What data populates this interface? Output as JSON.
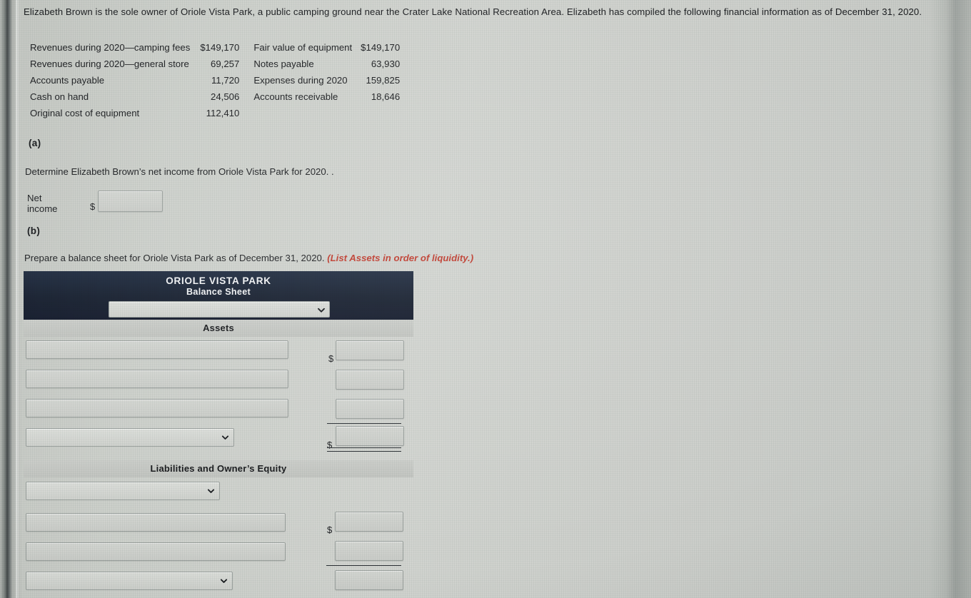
{
  "problem": {
    "intro": "Elizabeth Brown is the sole owner of Oriole Vista Park, a public camping ground near the Crater Lake National Recreation Area. Elizabeth has compiled the following financial information as of December 31, 2020.",
    "facts_left": [
      {
        "label": "Revenues during 2020—camping fees",
        "amount": "$149,170"
      },
      {
        "label": "Revenues during 2020—general store",
        "amount": "69,257"
      },
      {
        "label": "Accounts payable",
        "amount": "11,720"
      },
      {
        "label": "Cash on hand",
        "amount": "24,506"
      },
      {
        "label": "Original cost of equipment",
        "amount": "112,410"
      }
    ],
    "facts_right": [
      {
        "label": "Fair value of equipment",
        "amount": "$149,170"
      },
      {
        "label": "Notes payable",
        "amount": "63,930"
      },
      {
        "label": "Expenses during 2020",
        "amount": "159,825"
      },
      {
        "label": "Accounts receivable",
        "amount": "18,646"
      }
    ]
  },
  "part_a": {
    "label": "(a)",
    "question": "Determine Elizabeth Brown’s net income from Oriole Vista Park for 2020. .",
    "net_income_label": "Net income",
    "dollar_sign": "$",
    "net_income_value": "",
    "net_income_placeholder": ""
  },
  "part_b": {
    "label": "(b)",
    "question": "Prepare a balance sheet for Oriole Vista Park as of December 31, 2020.",
    "hint": "(List Assets in order of liquidity.)"
  },
  "balance_sheet": {
    "company": "ORIOLE VISTA PARK",
    "statement": "Balance Sheet",
    "date_select_value": "",
    "date_select_options": [
      ""
    ],
    "assets_band": "Assets",
    "liabilities_band": "Liabilities and Owner’s Equity",
    "dollar_sign": "$",
    "assets_rows": [
      {
        "type": "text",
        "label_value": "",
        "amount_value": "",
        "dollar": true,
        "rule": "none"
      },
      {
        "type": "text",
        "label_value": "",
        "amount_value": "",
        "dollar": false,
        "rule": "none"
      },
      {
        "type": "text",
        "label_value": "",
        "amount_value": "",
        "dollar": false,
        "rule": "single"
      },
      {
        "type": "select",
        "label_value": "",
        "amount_value": "",
        "dollar": true,
        "rule": "double"
      }
    ],
    "liability_rows": [
      {
        "type": "select",
        "label_value": "",
        "amount_value": null,
        "dollar": false,
        "rule": "none"
      },
      {
        "type": "text",
        "label_value": "",
        "amount_value": "",
        "dollar": true,
        "rule": "none"
      },
      {
        "type": "text",
        "label_value": "",
        "amount_value": "",
        "dollar": false,
        "rule": "single"
      },
      {
        "type": "select",
        "label_value": "",
        "amount_value": "",
        "dollar": false,
        "rule": "none"
      }
    ]
  },
  "colors": {
    "header_navy": "#141d2d",
    "hint_red": "#c0392b",
    "page_bg": "#cdd0cb",
    "field_border": "#9aa09d"
  }
}
